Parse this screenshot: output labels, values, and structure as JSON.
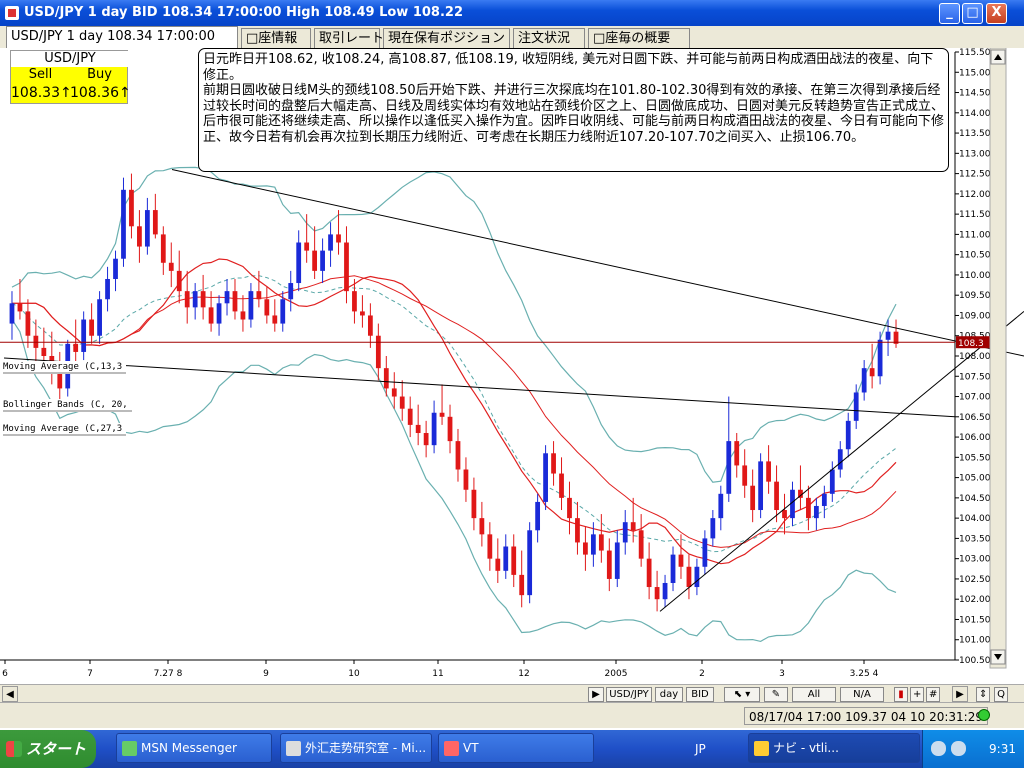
{
  "window": {
    "title": "USD/JPY 1 day BID 108.34 17:00:00 High 108.49 Low 108.22",
    "minimize": "_",
    "maximize": "□",
    "close": "X"
  },
  "tabs": [
    {
      "label": "USD/JPY 1 day 108.34 17:00:00",
      "active": true
    },
    {
      "label": "□座情報"
    },
    {
      "label": "取引レート"
    },
    {
      "label": "現在保有ポジション"
    },
    {
      "label": "注文状況"
    },
    {
      "label": "□座毎の概要"
    }
  ],
  "ticker": {
    "symbol": "USD/JPY",
    "sell_label": "Sell",
    "buy_label": "Buy",
    "sell_value": "108.33↑",
    "buy_value": "108.36↑"
  },
  "comment": {
    "para1": "日元昨日开108.62, 收108.24, 高108.87, 低108.19, 收短阴线, 美元对日圆下跌、并可能与前两日构成酒田战法的夜星、向下修正。",
    "para2": "前期日圆收破日线M头的颈线108.50后开始下跌、并进行三次探底均在101.80-102.30得到有效的承接、在第三次得到承接后经过较长时间的盘整后大幅走高、日线及周线实体均有效地站在颈线价区之上、日圆做底成功、日圆对美元反转趋势宣告正式成立、后市很可能还将继续走高、所以操作以逢低买入操作为宜。因昨日收阴线、可能与前两日构成酒田战法的夜星、今日有可能向下修正、故今日若有机会再次拉到长期压力线附近、可考虑在长期压力线附近107.20-107.70之间买入、止损106.70。"
  },
  "indicators": [
    "Moving Average (C,13,3",
    "Bollinger Bands (C, 20,",
    "Moving Average (C,27,3"
  ],
  "chart_data": {
    "type": "candlestick",
    "instrument": "USD/JPY",
    "timeframe": "1 day",
    "last_price": "108.34",
    "ylim": [
      100.5,
      115.5
    ],
    "y_ticks": [
      100.5,
      101.0,
      101.5,
      102.0,
      102.5,
      103.0,
      103.5,
      104.0,
      104.5,
      105.0,
      105.5,
      106.0,
      106.5,
      107.0,
      107.5,
      108.0,
      108.5,
      109.0,
      109.5,
      110.0,
      110.5,
      111.0,
      111.5,
      112.0,
      112.5,
      113.0,
      113.5,
      114.0,
      114.5,
      115.0,
      115.5
    ],
    "x_ticks": [
      "6",
      "7",
      "7.27 8",
      "9",
      "10",
      "11",
      "12",
      "2005",
      "2",
      "3",
      "3.25 4"
    ],
    "candles": [
      [
        108.8,
        109.6,
        108.4,
        109.3
      ],
      [
        109.3,
        109.9,
        108.9,
        109.1
      ],
      [
        109.1,
        109.4,
        108.2,
        108.5
      ],
      [
        108.5,
        108.9,
        107.8,
        108.2
      ],
      [
        108.2,
        108.7,
        107.6,
        108.0
      ],
      [
        108.0,
        108.6,
        107.3,
        107.6
      ],
      [
        107.6,
        108.1,
        106.9,
        107.2
      ],
      [
        107.2,
        108.4,
        107.0,
        108.3
      ],
      [
        108.3,
        108.9,
        107.8,
        108.1
      ],
      [
        108.1,
        109.1,
        107.9,
        108.9
      ],
      [
        108.9,
        109.3,
        108.3,
        108.5
      ],
      [
        108.5,
        109.6,
        108.3,
        109.4
      ],
      [
        109.4,
        110.2,
        109.1,
        109.9
      ],
      [
        109.9,
        110.6,
        109.6,
        110.4
      ],
      [
        110.4,
        112.4,
        110.2,
        112.1
      ],
      [
        112.1,
        112.5,
        110.9,
        111.2
      ],
      [
        111.2,
        111.6,
        110.3,
        110.7
      ],
      [
        110.7,
        111.9,
        110.5,
        111.6
      ],
      [
        111.6,
        112.0,
        110.9,
        111.0
      ],
      [
        111.0,
        111.2,
        110.0,
        110.3
      ],
      [
        110.3,
        110.8,
        109.7,
        110.1
      ],
      [
        110.1,
        110.6,
        109.3,
        109.6
      ],
      [
        109.6,
        110.1,
        108.8,
        109.2
      ],
      [
        109.2,
        109.8,
        108.9,
        109.6
      ],
      [
        109.6,
        110.0,
        108.9,
        109.2
      ],
      [
        109.2,
        109.6,
        108.6,
        108.8
      ],
      [
        108.8,
        109.5,
        108.5,
        109.3
      ],
      [
        109.3,
        109.9,
        109.0,
        109.6
      ],
      [
        109.6,
        109.9,
        108.9,
        109.1
      ],
      [
        109.1,
        109.5,
        108.6,
        108.9
      ],
      [
        108.9,
        109.8,
        108.7,
        109.6
      ],
      [
        109.6,
        110.1,
        109.2,
        109.4
      ],
      [
        109.4,
        109.7,
        108.8,
        109.0
      ],
      [
        109.0,
        109.4,
        108.6,
        108.8
      ],
      [
        108.8,
        109.6,
        108.6,
        109.4
      ],
      [
        109.4,
        110.1,
        109.1,
        109.8
      ],
      [
        109.8,
        111.1,
        109.6,
        110.8
      ],
      [
        110.8,
        111.5,
        110.3,
        110.6
      ],
      [
        110.6,
        111.2,
        109.9,
        110.1
      ],
      [
        110.1,
        110.9,
        109.8,
        110.6
      ],
      [
        110.6,
        111.3,
        110.2,
        111.0
      ],
      [
        111.0,
        111.6,
        110.5,
        110.8
      ],
      [
        110.8,
        111.2,
        109.3,
        109.6
      ],
      [
        109.6,
        109.9,
        108.8,
        109.1
      ],
      [
        109.1,
        109.5,
        108.7,
        109.0
      ],
      [
        109.0,
        109.3,
        108.2,
        108.5
      ],
      [
        108.5,
        108.8,
        107.4,
        107.7
      ],
      [
        107.7,
        108.0,
        107.0,
        107.2
      ],
      [
        107.2,
        107.6,
        106.7,
        107.0
      ],
      [
        107.0,
        107.4,
        106.4,
        106.7
      ],
      [
        106.7,
        107.0,
        106.0,
        106.3
      ],
      [
        106.3,
        106.8,
        105.8,
        106.1
      ],
      [
        106.1,
        106.4,
        105.5,
        105.8
      ],
      [
        105.8,
        106.9,
        105.6,
        106.6
      ],
      [
        106.6,
        107.3,
        106.3,
        106.5
      ],
      [
        106.5,
        106.8,
        105.6,
        105.9
      ],
      [
        105.9,
        106.2,
        104.9,
        105.2
      ],
      [
        105.2,
        105.5,
        104.4,
        104.7
      ],
      [
        104.7,
        105.0,
        103.7,
        104.0
      ],
      [
        104.0,
        104.4,
        103.3,
        103.6
      ],
      [
        103.6,
        103.9,
        102.7,
        103.0
      ],
      [
        103.0,
        103.5,
        102.4,
        102.7
      ],
      [
        102.7,
        103.6,
        102.5,
        103.3
      ],
      [
        103.3,
        103.6,
        102.3,
        102.6
      ],
      [
        102.6,
        103.2,
        101.8,
        102.1
      ],
      [
        102.1,
        103.9,
        101.9,
        103.7
      ],
      [
        103.7,
        104.6,
        103.4,
        104.4
      ],
      [
        104.4,
        105.8,
        104.2,
        105.6
      ],
      [
        105.6,
        105.9,
        104.8,
        105.1
      ],
      [
        105.1,
        105.5,
        104.2,
        104.5
      ],
      [
        104.5,
        104.9,
        103.6,
        104.0
      ],
      [
        104.0,
        104.4,
        103.1,
        103.4
      ],
      [
        103.4,
        103.8,
        102.7,
        103.1
      ],
      [
        103.1,
        103.9,
        102.8,
        103.6
      ],
      [
        103.6,
        104.1,
        102.9,
        103.2
      ],
      [
        103.2,
        103.5,
        102.2,
        102.5
      ],
      [
        102.5,
        103.7,
        102.3,
        103.4
      ],
      [
        103.4,
        104.2,
        103.1,
        103.9
      ],
      [
        103.9,
        104.5,
        103.4,
        103.7
      ],
      [
        103.7,
        104.1,
        102.8,
        103.0
      ],
      [
        103.0,
        103.4,
        102.0,
        102.3
      ],
      [
        102.3,
        102.7,
        101.7,
        102.0
      ],
      [
        102.0,
        102.6,
        101.8,
        102.4
      ],
      [
        102.4,
        103.3,
        102.2,
        103.1
      ],
      [
        103.1,
        103.6,
        102.5,
        102.8
      ],
      [
        102.8,
        103.1,
        102.0,
        102.3
      ],
      [
        102.3,
        103.0,
        102.1,
        102.8
      ],
      [
        102.8,
        103.7,
        102.6,
        103.5
      ],
      [
        103.5,
        104.2,
        103.3,
        104.0
      ],
      [
        104.0,
        104.8,
        103.7,
        104.6
      ],
      [
        104.6,
        107.0,
        104.4,
        105.9
      ],
      [
        105.9,
        106.1,
        105.0,
        105.3
      ],
      [
        105.3,
        105.7,
        104.5,
        104.8
      ],
      [
        104.8,
        105.2,
        103.9,
        104.2
      ],
      [
        104.2,
        105.6,
        104.0,
        105.4
      ],
      [
        105.4,
        105.8,
        104.6,
        104.9
      ],
      [
        104.9,
        105.3,
        103.9,
        104.2
      ],
      [
        104.2,
        104.6,
        103.6,
        104.0
      ],
      [
        104.0,
        104.9,
        103.8,
        104.7
      ],
      [
        104.7,
        105.3,
        104.2,
        104.5
      ],
      [
        104.5,
        104.8,
        103.7,
        104.0
      ],
      [
        104.0,
        104.5,
        103.7,
        104.3
      ],
      [
        104.3,
        104.8,
        104.0,
        104.6
      ],
      [
        104.6,
        105.4,
        104.4,
        105.2
      ],
      [
        105.2,
        105.9,
        105.0,
        105.7
      ],
      [
        105.7,
        106.6,
        105.5,
        106.4
      ],
      [
        106.4,
        107.3,
        106.2,
        107.1
      ],
      [
        107.1,
        107.9,
        106.9,
        107.7
      ],
      [
        107.7,
        108.3,
        107.2,
        107.5
      ],
      [
        107.5,
        108.6,
        107.3,
        108.4
      ],
      [
        108.4,
        108.9,
        108.0,
        108.6
      ],
      [
        108.6,
        108.9,
        108.2,
        108.3
      ]
    ],
    "lines": [
      {
        "name": "長期压力线",
        "from": [
          112.6,
          "7.27"
        ],
        "to": [
          108.4,
          "end"
        ]
      },
      {
        "name": "颈线",
        "from": [
          107.9,
          "6"
        ],
        "to": [
          106.5,
          "end"
        ]
      },
      {
        "name": "上升趋势线",
        "from": [
          101.7,
          "2"
        ],
        "to": [
          108.4,
          "end"
        ]
      }
    ],
    "current_price_line": 108.34,
    "price_label": "108.3"
  },
  "scrollbar": {
    "buttons": [
      "USD/JPY",
      "day",
      "BID",
      "All",
      "N/A"
    ]
  },
  "status": {
    "text": "08/17/04 17:00     109.37 04 10 20:31:29"
  },
  "taskbar": {
    "start": "スタート",
    "tasks": [
      {
        "label": "MSN Messenger"
      },
      {
        "label": "外汇走势研究室 - Mi..."
      },
      {
        "label": "VT"
      },
      {
        "label": "ナビ - vtli..."
      }
    ],
    "lang": "JP",
    "clock": "9:31"
  }
}
